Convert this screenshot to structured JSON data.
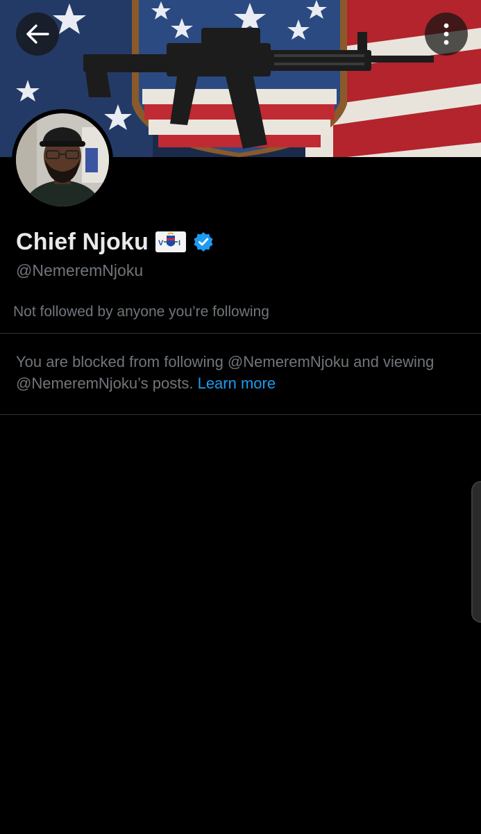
{
  "header": {
    "back_icon": "arrow-left-icon",
    "more_icon": "more-vertical-icon"
  },
  "profile": {
    "display_name": "Chief Njoku",
    "flag_icon": "us-virgin-islands-flag-icon",
    "verified_icon": "verified-badge-icon",
    "handle": "@NemeremNjoku",
    "followers_note": "Not followed by anyone you’re following"
  },
  "blocked": {
    "message": "You are blocked from following @NemeremNjoku and viewing @NemeremNjoku’s posts.",
    "learn_more": "Learn more"
  },
  "colors": {
    "background": "#000000",
    "primary_text": "#e7e9ea",
    "secondary_text": "#71767b",
    "link": "#1d9bf0",
    "verified": "#1d9bf0",
    "divider": "#2f3336"
  }
}
